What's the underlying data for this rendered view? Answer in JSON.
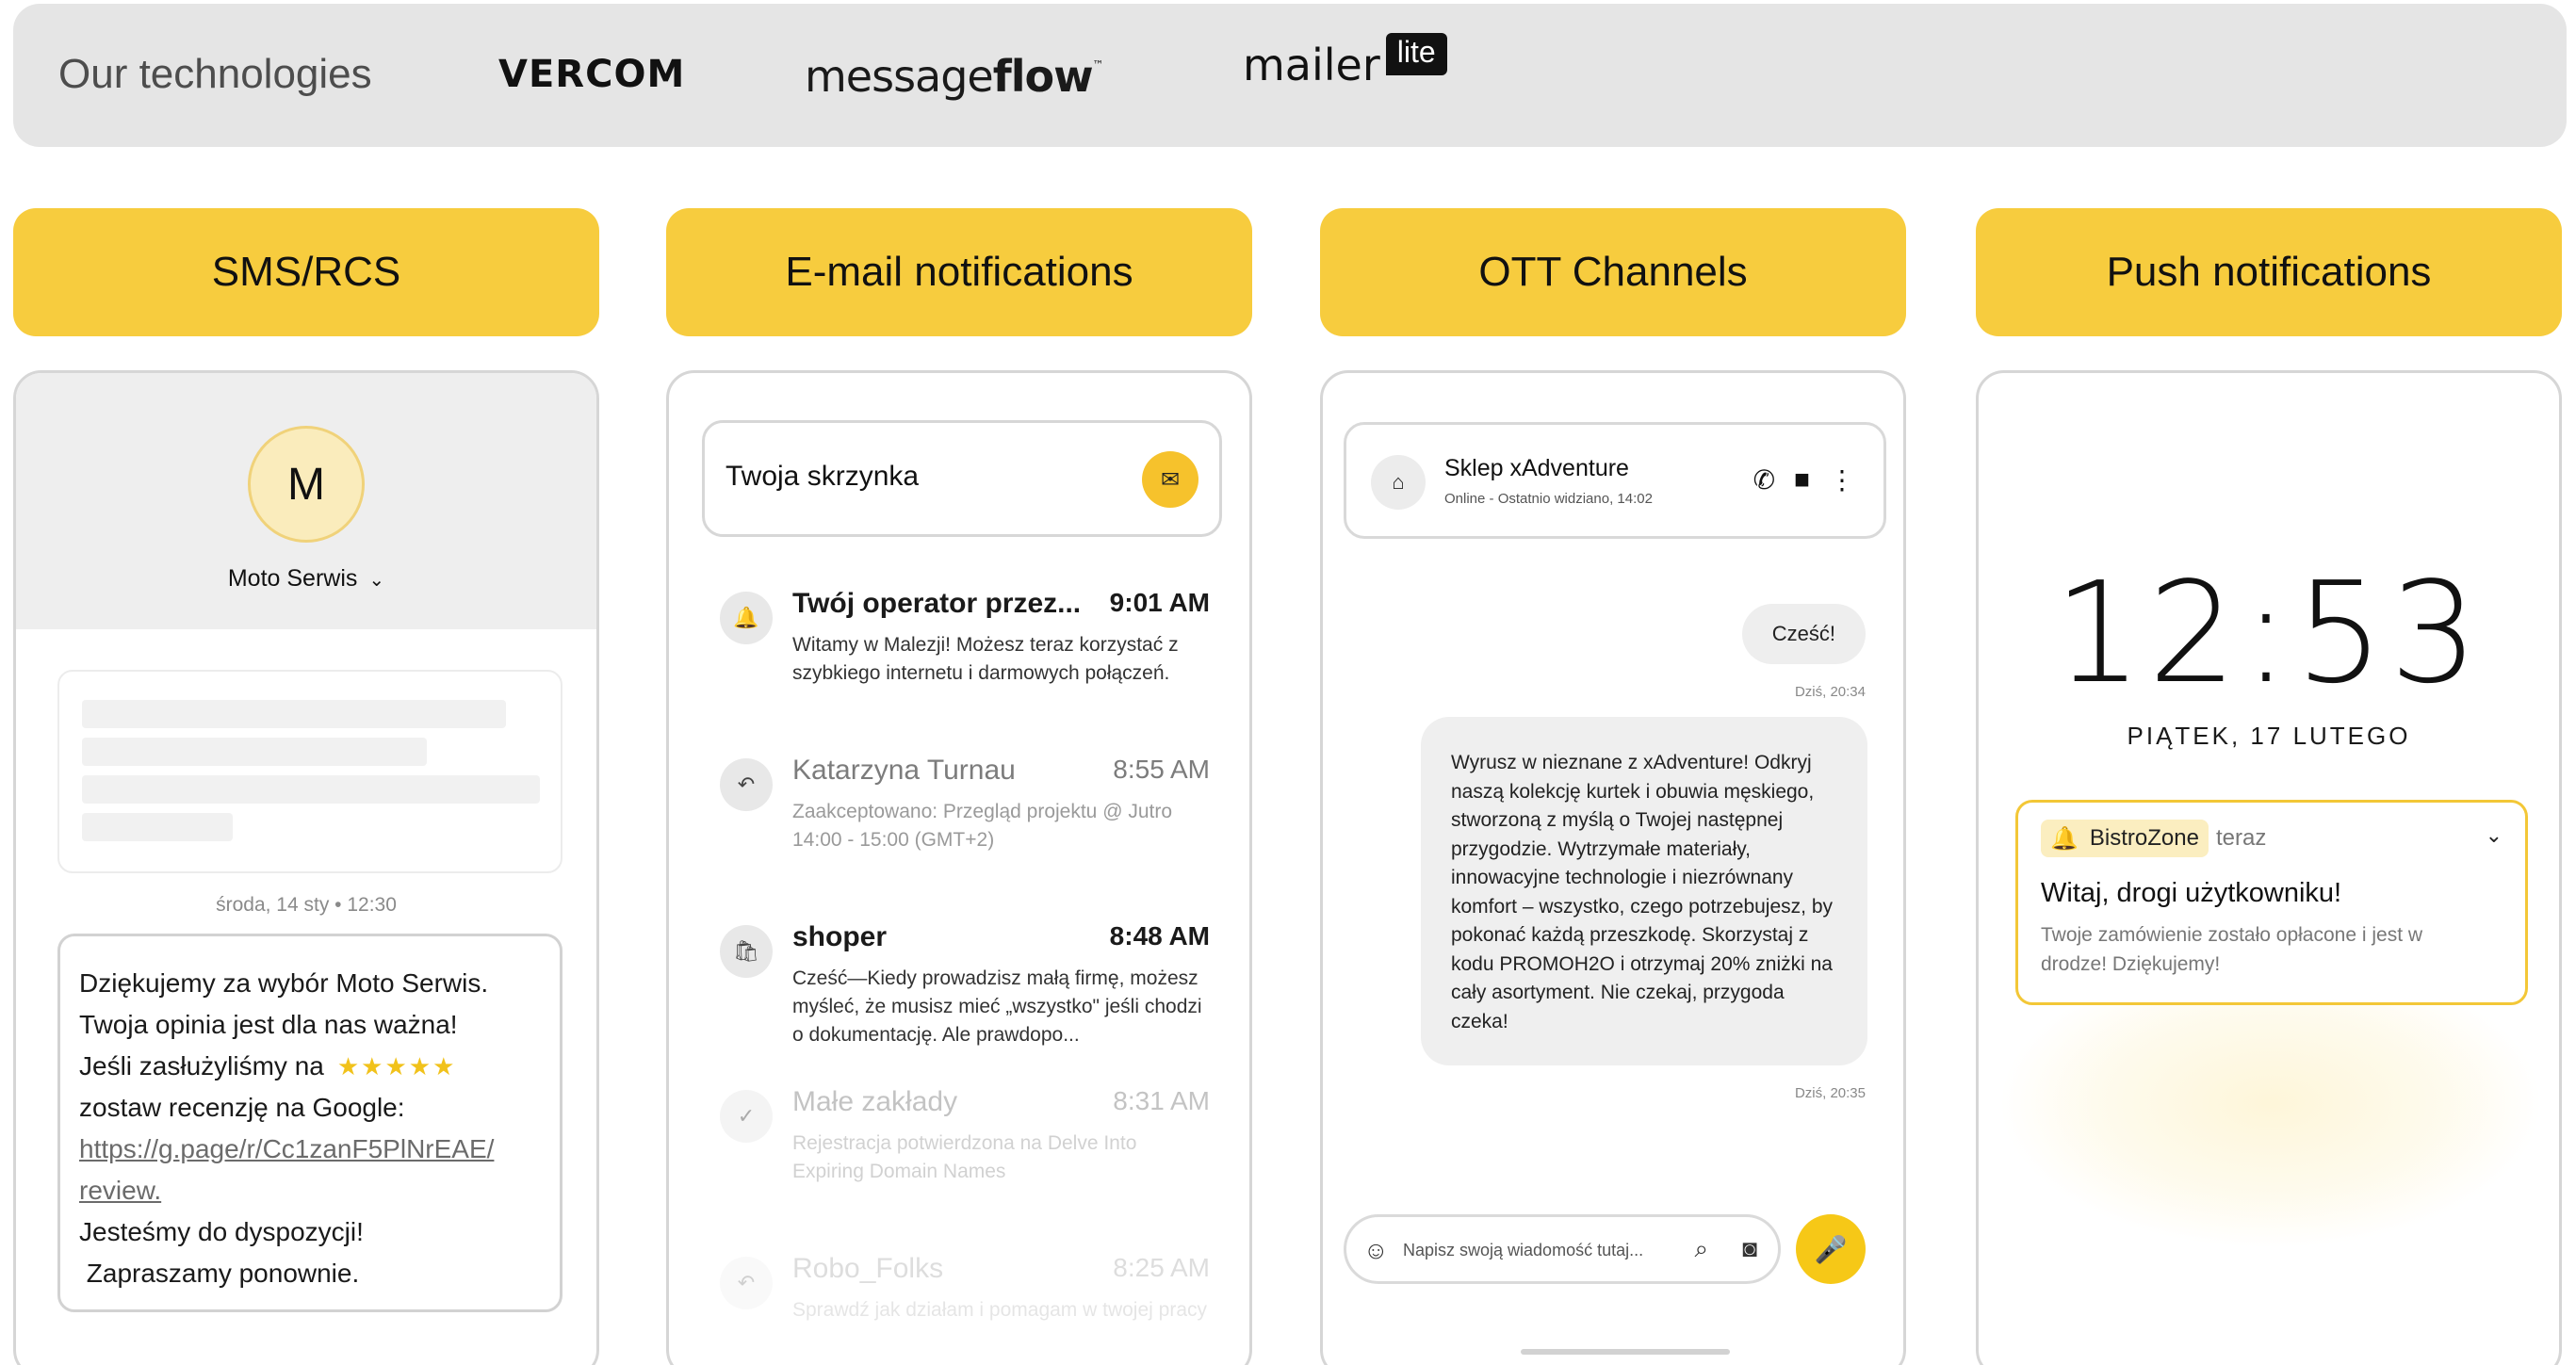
{
  "technologies": {
    "title": "Our technologies",
    "logos": {
      "vercom": "VERCOM",
      "messageflow_a": "message",
      "messageflow_b": "flow",
      "messageflow_tm": "™",
      "mailerlite_a": "mailer",
      "mailerlite_b": "lite"
    }
  },
  "categories": [
    "SMS/RCS",
    "E-mail notifications",
    "OTT Channels",
    "Push notifications"
  ],
  "sms": {
    "avatar_letter": "M",
    "contact_name": "Moto Serwis",
    "date_line": "środa, 14 sty • 12:30",
    "message": {
      "l1a": "Dziękujemy za wybór ",
      "l1b": "Moto Serwis",
      "l1c": ".",
      "l2": "Twoja opinia jest dla nas ważna!",
      "l3": "Jeśli zasłużyliśmy na",
      "stars": "★★★★★",
      "l4": "zostaw recenzję na Google:",
      "link_a": "https://g.page/r/Cc1zanF5PlNrEAE/",
      "link_b": "review.",
      "l5": "Jesteśmy do dyspozycji!",
      "l6": " Zapraszamy ponownie."
    },
    "rating": 5
  },
  "email": {
    "inbox_title": "Twoja skrzynka",
    "items": [
      {
        "sender": "Twój operator przez...",
        "time": "9:01 AM",
        "body": "Witamy w Malezji! Możesz teraz korzystać z szybkiego internetu i darmowych połączeń.",
        "icon": "bell-icon",
        "glyph": "🔔"
      },
      {
        "sender": "Katarzyna Turnau",
        "time": "8:55 AM",
        "body": "Zaakceptowano: Przegląd projektu @ Jutro 14:00 - 15:00 (GMT+2)",
        "icon": "reply-icon",
        "glyph": "↶"
      },
      {
        "sender": "shoper",
        "time": "8:48 AM",
        "body": "Cześć—Kiedy prowadzisz małą firmę, możesz myśleć, że musisz mieć „wszystko\" jeśli chodzi o dokumentację. Ale prawdopo...",
        "icon": "bag-icon",
        "glyph": "🛍"
      },
      {
        "sender": "Małe zakłady",
        "time": "8:31 AM",
        "body": "Rejestracja potwierdzona na Delve Into Expiring Domain Names",
        "icon": "check-icon",
        "glyph": "✓"
      },
      {
        "sender": "Robo_Folks",
        "time": "8:25 AM",
        "body": "Sprawdź jak działam i pomagam w twojej pracy",
        "icon": "reply-icon",
        "glyph": "↶"
      }
    ]
  },
  "ott": {
    "shop_name": "Sklep xAdventure",
    "shop_status": "Online - Ostatnio widziano, 14:02",
    "greeting": "Cześć!",
    "greeting_time": "Dziś, 20:34",
    "message": "Wyrusz w nieznane z xAdventure! Odkryj naszą kolekcję kurtek i obuwia męskiego, stworzoną z myślą o Twojej następnej przygodzie. Wytrzymałe materiały, innowacyjne technologie i niezrównany komfort – wszystko, czego potrzebujesz, by pokonać każdą przeszkodę. Skorzystaj z kodu PROMOH2O i otrzymaj 20% zniżki na cały asortyment. Nie czekaj, przygoda czeka!",
    "message_time": "Dziś, 20:35",
    "input_placeholder": "Napisz swoją wiadomość tutaj..."
  },
  "push": {
    "time": "12:53",
    "date": "PIĄTEK, 17 LUTEGO",
    "app_name": "BistroZone",
    "when": "teraz",
    "title": "Witaj, drogi użytkowniku!",
    "body": "Twoje zamówienie zostało opłacone i jest w drodze! Dziękujemy!"
  },
  "colors": {
    "accent_yellow": "#f7cc3e",
    "bar_gray": "#e5e5e5"
  }
}
